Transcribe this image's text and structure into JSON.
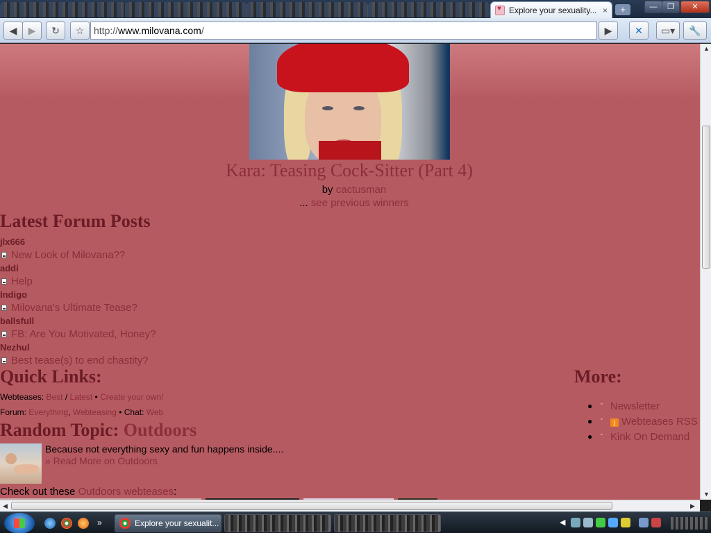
{
  "browser": {
    "tab_title": "Explore your sexuality...",
    "tab_close": "×",
    "new_tab": "+",
    "url_prefix": "http://",
    "url_host": "www.milovana.com",
    "url_path": "/",
    "back_label": "◀",
    "forward_label": "▶",
    "reload_label": "↻",
    "star_label": "☆",
    "go_label": "▶",
    "minimize_label": "—",
    "maximize_label": "❐",
    "close_label": "✕"
  },
  "page": {
    "winner": {
      "title": "Kara: Teasing Cock-Sitter (Part 4)",
      "by_prefix": "by ",
      "author": "cactusman",
      "prev_prefix": "... ",
      "prev_link": "see previous winners"
    },
    "latest_forum": {
      "heading": "Latest Forum Posts",
      "posts": [
        {
          "author": "jlx666",
          "title": "New Look of Milovana??"
        },
        {
          "author": "addi",
          "title": "Help"
        },
        {
          "author": "Indigo",
          "title": "Milovana's Ultimate Tease?"
        },
        {
          "author": "ballsfull",
          "title": "FB: Are You Motivated, Honey?"
        },
        {
          "author": "Nezhul",
          "title": "Best tease(s) to end chastity?"
        }
      ]
    },
    "quick_links": {
      "heading": "Quick Links:",
      "webteases_label": "Webteases: ",
      "best": "Best",
      "slash": " / ",
      "latest": "Latest",
      "bullet": " • ",
      "create": "Create your own!",
      "forum_label": "Forum: ",
      "everything": "Everything",
      "comma": ", ",
      "webteasing": "Webteasing",
      "chat_label": "Chat: ",
      "web": "Web"
    },
    "random_topic": {
      "heading_prefix": "Random Topic: ",
      "topic": "Outdoors",
      "description": "Because not everything sexy and fun happens inside....",
      "read_more": "» Read More on Outdoors",
      "checkout_prefix": "Check out these ",
      "checkout_link": "Outdoors webteases",
      "checkout_suffix": ":"
    },
    "more": {
      "heading": "More:",
      "items": [
        {
          "label": "Newsletter"
        },
        {
          "label": "Webteases RSS"
        },
        {
          "label": "Kink On Demand"
        }
      ]
    }
  },
  "taskbar": {
    "active_task": "Explore your sexualit..."
  }
}
